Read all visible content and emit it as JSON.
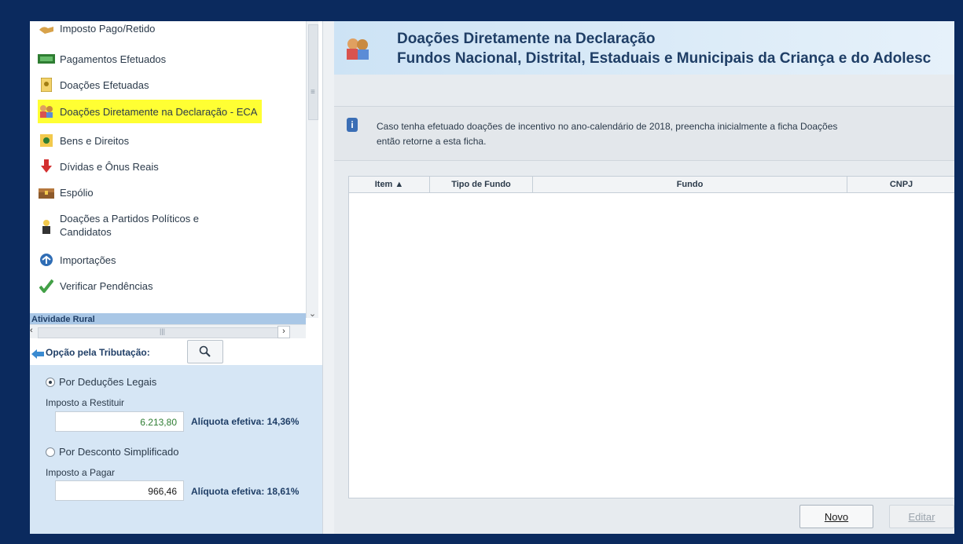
{
  "nav": {
    "items": [
      {
        "label": "Imposto Pago/Retido",
        "icon": "money-hand-icon"
      },
      {
        "label": "Pagamentos Efetuados",
        "icon": "cash-icon"
      },
      {
        "label": "Doações Efetuadas",
        "icon": "document-icon"
      },
      {
        "label": "Doações Diretamente na Declaração - ECA",
        "icon": "children-icon",
        "selected": true
      },
      {
        "label": "Bens e Direitos",
        "icon": "coin-icon"
      },
      {
        "label": "Dívidas e Ônus Reais",
        "icon": "arrow-down-icon"
      },
      {
        "label": "Espólio",
        "icon": "chest-icon"
      },
      {
        "label": "Doações a Partidos Políticos e",
        "label2": "Candidatos",
        "icon": "candidate-icon"
      },
      {
        "label": "Importações",
        "icon": "import-icon"
      },
      {
        "label": "Verificar Pendências",
        "icon": "check-icon"
      }
    ],
    "section_label": "Atividade Rural"
  },
  "tax": {
    "header_label": "Opção pela Tributação:",
    "option1_label": "Por Deduções Legais",
    "option1_sub": "Imposto a Restituir",
    "option1_value": "6.213,80",
    "option1_aliquota": "Alíquota efetiva: 14,36%",
    "option2_label": "Por Desconto Simplificado",
    "option2_sub": "Imposto a Pagar",
    "option2_value": "966,46",
    "option2_aliquota": "Alíquota efetiva: 18,61%"
  },
  "main": {
    "title_line1": "Doações Diretamente na Declaração",
    "title_line2": "Fundos Nacional, Distrital, Estaduais e Municipais da Criança e do Adolesc",
    "info_line1": "Caso tenha efetuado doações de incentivo no ano-calendário de 2018, preencha inicialmente a ficha Doações",
    "info_line2": "então retorne a esta ficha.",
    "columns": [
      "Item ▲",
      "Tipo de Fundo",
      "Fundo",
      "CNPJ"
    ],
    "btn_novo": "Novo",
    "btn_editar": "Editar"
  },
  "colors": {
    "accent": "#1f3e66",
    "selected": "#ffff33",
    "frame": "#0b2a5e"
  }
}
